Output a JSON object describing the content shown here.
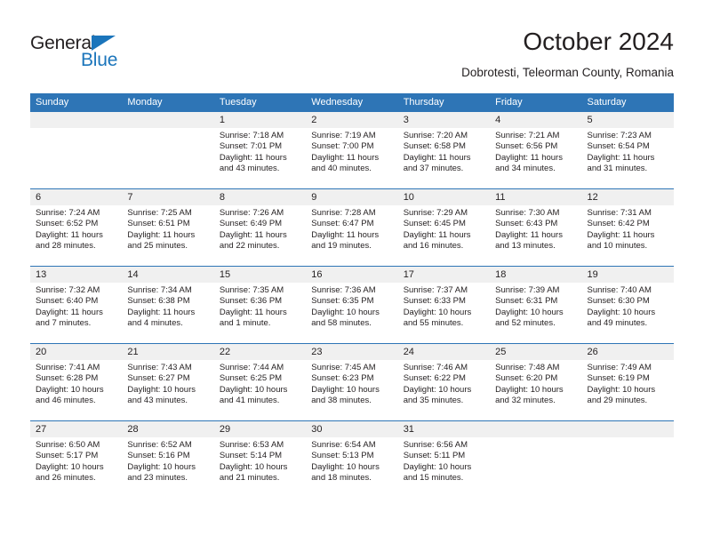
{
  "logo": {
    "word1": "General",
    "word2": "Blue",
    "triangle_color": "#1b75bb"
  },
  "header": {
    "title": "October 2024",
    "subtitle": "Dobrotesti, Teleorman County, Romania"
  },
  "theme": {
    "header_blue": "#2e75b6",
    "daynum_band": "#f0f0f0",
    "text": "#231f20"
  },
  "weekdays": [
    "Sunday",
    "Monday",
    "Tuesday",
    "Wednesday",
    "Thursday",
    "Friday",
    "Saturday"
  ],
  "weeks": [
    [
      {
        "day": "",
        "sunrise": "",
        "sunset": "",
        "daylight": ""
      },
      {
        "day": "",
        "sunrise": "",
        "sunset": "",
        "daylight": ""
      },
      {
        "day": "1",
        "sunrise": "Sunrise: 7:18 AM",
        "sunset": "Sunset: 7:01 PM",
        "daylight": "Daylight: 11 hours and 43 minutes."
      },
      {
        "day": "2",
        "sunrise": "Sunrise: 7:19 AM",
        "sunset": "Sunset: 7:00 PM",
        "daylight": "Daylight: 11 hours and 40 minutes."
      },
      {
        "day": "3",
        "sunrise": "Sunrise: 7:20 AM",
        "sunset": "Sunset: 6:58 PM",
        "daylight": "Daylight: 11 hours and 37 minutes."
      },
      {
        "day": "4",
        "sunrise": "Sunrise: 7:21 AM",
        "sunset": "Sunset: 6:56 PM",
        "daylight": "Daylight: 11 hours and 34 minutes."
      },
      {
        "day": "5",
        "sunrise": "Sunrise: 7:23 AM",
        "sunset": "Sunset: 6:54 PM",
        "daylight": "Daylight: 11 hours and 31 minutes."
      }
    ],
    [
      {
        "day": "6",
        "sunrise": "Sunrise: 7:24 AM",
        "sunset": "Sunset: 6:52 PM",
        "daylight": "Daylight: 11 hours and 28 minutes."
      },
      {
        "day": "7",
        "sunrise": "Sunrise: 7:25 AM",
        "sunset": "Sunset: 6:51 PM",
        "daylight": "Daylight: 11 hours and 25 minutes."
      },
      {
        "day": "8",
        "sunrise": "Sunrise: 7:26 AM",
        "sunset": "Sunset: 6:49 PM",
        "daylight": "Daylight: 11 hours and 22 minutes."
      },
      {
        "day": "9",
        "sunrise": "Sunrise: 7:28 AM",
        "sunset": "Sunset: 6:47 PM",
        "daylight": "Daylight: 11 hours and 19 minutes."
      },
      {
        "day": "10",
        "sunrise": "Sunrise: 7:29 AM",
        "sunset": "Sunset: 6:45 PM",
        "daylight": "Daylight: 11 hours and 16 minutes."
      },
      {
        "day": "11",
        "sunrise": "Sunrise: 7:30 AM",
        "sunset": "Sunset: 6:43 PM",
        "daylight": "Daylight: 11 hours and 13 minutes."
      },
      {
        "day": "12",
        "sunrise": "Sunrise: 7:31 AM",
        "sunset": "Sunset: 6:42 PM",
        "daylight": "Daylight: 11 hours and 10 minutes."
      }
    ],
    [
      {
        "day": "13",
        "sunrise": "Sunrise: 7:32 AM",
        "sunset": "Sunset: 6:40 PM",
        "daylight": "Daylight: 11 hours and 7 minutes."
      },
      {
        "day": "14",
        "sunrise": "Sunrise: 7:34 AM",
        "sunset": "Sunset: 6:38 PM",
        "daylight": "Daylight: 11 hours and 4 minutes."
      },
      {
        "day": "15",
        "sunrise": "Sunrise: 7:35 AM",
        "sunset": "Sunset: 6:36 PM",
        "daylight": "Daylight: 11 hours and 1 minute."
      },
      {
        "day": "16",
        "sunrise": "Sunrise: 7:36 AM",
        "sunset": "Sunset: 6:35 PM",
        "daylight": "Daylight: 10 hours and 58 minutes."
      },
      {
        "day": "17",
        "sunrise": "Sunrise: 7:37 AM",
        "sunset": "Sunset: 6:33 PM",
        "daylight": "Daylight: 10 hours and 55 minutes."
      },
      {
        "day": "18",
        "sunrise": "Sunrise: 7:39 AM",
        "sunset": "Sunset: 6:31 PM",
        "daylight": "Daylight: 10 hours and 52 minutes."
      },
      {
        "day": "19",
        "sunrise": "Sunrise: 7:40 AM",
        "sunset": "Sunset: 6:30 PM",
        "daylight": "Daylight: 10 hours and 49 minutes."
      }
    ],
    [
      {
        "day": "20",
        "sunrise": "Sunrise: 7:41 AM",
        "sunset": "Sunset: 6:28 PM",
        "daylight": "Daylight: 10 hours and 46 minutes."
      },
      {
        "day": "21",
        "sunrise": "Sunrise: 7:43 AM",
        "sunset": "Sunset: 6:27 PM",
        "daylight": "Daylight: 10 hours and 43 minutes."
      },
      {
        "day": "22",
        "sunrise": "Sunrise: 7:44 AM",
        "sunset": "Sunset: 6:25 PM",
        "daylight": "Daylight: 10 hours and 41 minutes."
      },
      {
        "day": "23",
        "sunrise": "Sunrise: 7:45 AM",
        "sunset": "Sunset: 6:23 PM",
        "daylight": "Daylight: 10 hours and 38 minutes."
      },
      {
        "day": "24",
        "sunrise": "Sunrise: 7:46 AM",
        "sunset": "Sunset: 6:22 PM",
        "daylight": "Daylight: 10 hours and 35 minutes."
      },
      {
        "day": "25",
        "sunrise": "Sunrise: 7:48 AM",
        "sunset": "Sunset: 6:20 PM",
        "daylight": "Daylight: 10 hours and 32 minutes."
      },
      {
        "day": "26",
        "sunrise": "Sunrise: 7:49 AM",
        "sunset": "Sunset: 6:19 PM",
        "daylight": "Daylight: 10 hours and 29 minutes."
      }
    ],
    [
      {
        "day": "27",
        "sunrise": "Sunrise: 6:50 AM",
        "sunset": "Sunset: 5:17 PM",
        "daylight": "Daylight: 10 hours and 26 minutes."
      },
      {
        "day": "28",
        "sunrise": "Sunrise: 6:52 AM",
        "sunset": "Sunset: 5:16 PM",
        "daylight": "Daylight: 10 hours and 23 minutes."
      },
      {
        "day": "29",
        "sunrise": "Sunrise: 6:53 AM",
        "sunset": "Sunset: 5:14 PM",
        "daylight": "Daylight: 10 hours and 21 minutes."
      },
      {
        "day": "30",
        "sunrise": "Sunrise: 6:54 AM",
        "sunset": "Sunset: 5:13 PM",
        "daylight": "Daylight: 10 hours and 18 minutes."
      },
      {
        "day": "31",
        "sunrise": "Sunrise: 6:56 AM",
        "sunset": "Sunset: 5:11 PM",
        "daylight": "Daylight: 10 hours and 15 minutes."
      },
      {
        "day": "",
        "sunrise": "",
        "sunset": "",
        "daylight": ""
      },
      {
        "day": "",
        "sunrise": "",
        "sunset": "",
        "daylight": ""
      }
    ]
  ]
}
